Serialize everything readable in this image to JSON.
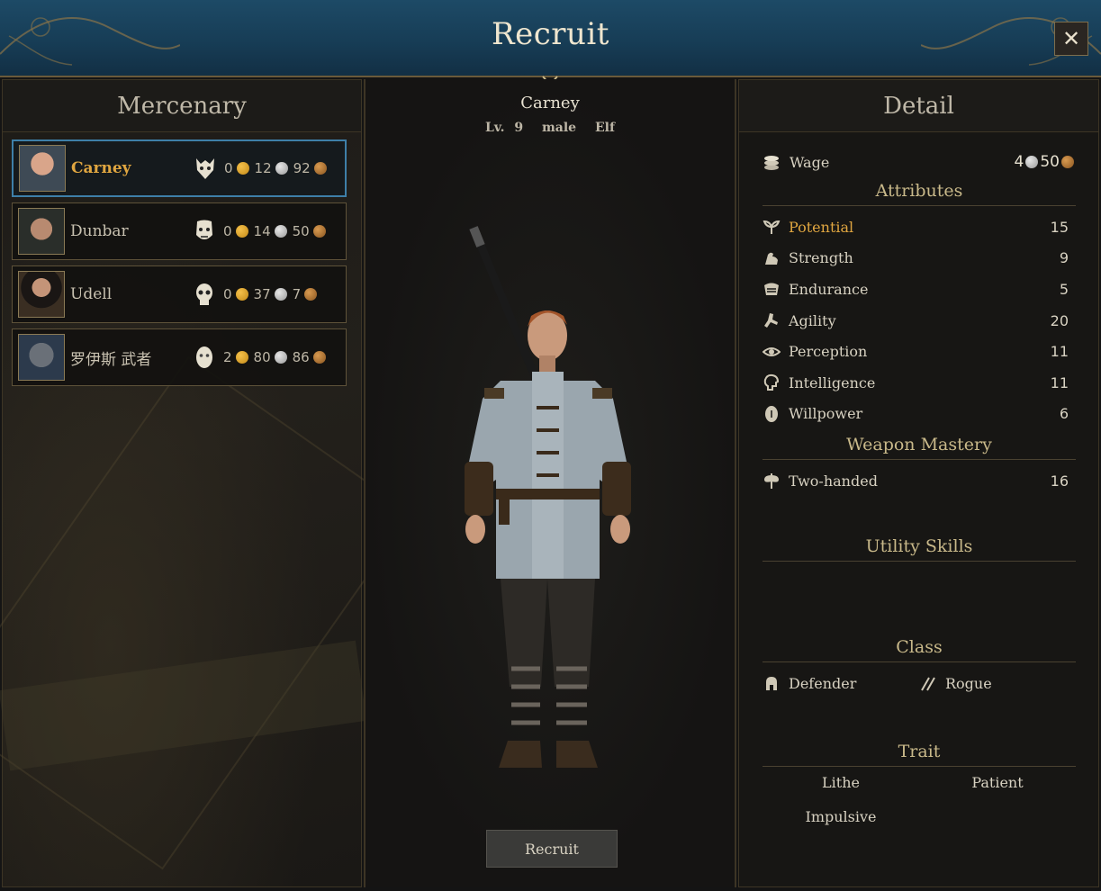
{
  "window": {
    "title": "Recruit",
    "close_label": "✕"
  },
  "mercenary_panel": {
    "title": "Mercenary",
    "items": [
      {
        "name": "Carney",
        "race_icon": "demon-mask-icon",
        "gold": "0",
        "silver": "12",
        "bronze": "92",
        "selected": true
      },
      {
        "name": "Dunbar",
        "race_icon": "orc-mask-icon",
        "gold": "0",
        "silver": "14",
        "bronze": "50",
        "selected": false
      },
      {
        "name": "Udell",
        "race_icon": "skull-mask-icon",
        "gold": "0",
        "silver": "37",
        "bronze": "7",
        "selected": false
      },
      {
        "name": "罗伊斯 武者",
        "race_icon": "human-mask-icon",
        "gold": "2",
        "silver": "80",
        "bronze": "86",
        "selected": false
      }
    ]
  },
  "character": {
    "name": "Carney",
    "level_label": "Lv. 9",
    "gender": "male",
    "race": "Elf",
    "recruit_button": "Recruit"
  },
  "detail": {
    "title": "Detail",
    "wage": {
      "label": "Wage",
      "silver": "4",
      "bronze": "50"
    },
    "attributes_title": "Attributes",
    "attributes": [
      {
        "label": "Potential",
        "value": "15",
        "icon": "sprout-icon"
      },
      {
        "label": "Strength",
        "value": "9",
        "icon": "arm-flex-icon"
      },
      {
        "label": "Endurance",
        "value": "5",
        "icon": "chest-icon"
      },
      {
        "label": "Agility",
        "value": "20",
        "icon": "running-leg-icon"
      },
      {
        "label": "Perception",
        "value": "11",
        "icon": "eye-icon"
      },
      {
        "label": "Intelligence",
        "value": "11",
        "icon": "head-icon"
      },
      {
        "label": "Willpower",
        "value": "6",
        "icon": "heart-shield-icon"
      }
    ],
    "weapon_mastery_title": "Weapon Mastery",
    "weapon_mastery": [
      {
        "label": "Two-handed",
        "value": "16",
        "icon": "double-axe-icon"
      }
    ],
    "utility_title": "Utility Skills",
    "class_title": "Class",
    "classes": [
      {
        "label": "Defender",
        "icon": "helmet-icon"
      },
      {
        "label": "Rogue",
        "icon": "daggers-icon"
      }
    ],
    "trait_title": "Trait",
    "traits": [
      "Lithe",
      "Patient",
      "Impulsive"
    ]
  },
  "colors": {
    "accent_gold": "#e0a640",
    "selection_blue": "#3e7fa8",
    "header_blue": "#1d4a66"
  }
}
